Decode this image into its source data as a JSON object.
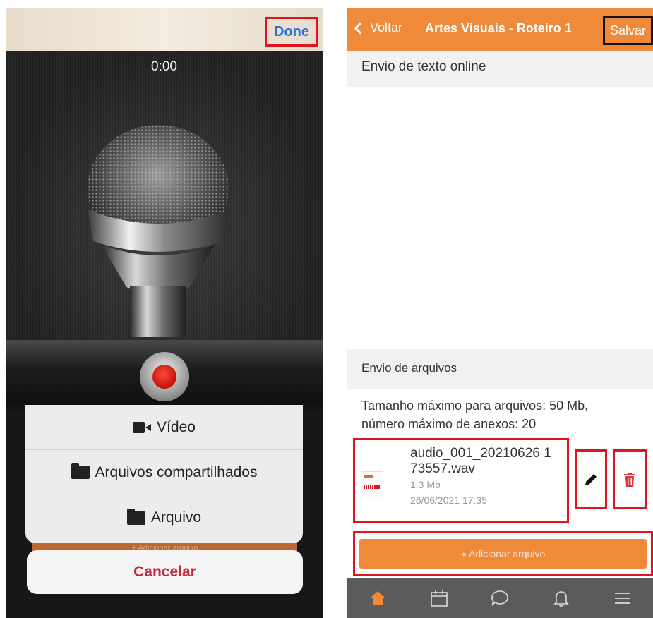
{
  "recorder": {
    "done_label": "Done",
    "timer": "0:00",
    "sheet": {
      "items": [
        {
          "label": "Vídeo",
          "icon": "video-camera-icon"
        },
        {
          "label": "Arquivos compartilhados",
          "icon": "folder-icon"
        },
        {
          "label": "Arquivo",
          "icon": "folder-icon"
        }
      ],
      "underlying_button": "+ Adicionar arquivo",
      "cancel_label": "Cancelar"
    }
  },
  "app": {
    "nav": {
      "back_label": "Voltar",
      "title": "Artes Visuais - Roteiro 1",
      "save_label": "Salvar"
    },
    "online_text": {
      "header": "Envio de texto online"
    },
    "files": {
      "header": "Envio de arquivos",
      "limits_line1": "Tamanho máximo para arquivos: 50 Mb,",
      "limits_line2": "número máximo de anexos: 20",
      "items": [
        {
          "name": "audio_001_20210626 173557.wav",
          "size": "1.3 Mb",
          "date": "26/06/2021 17:35"
        }
      ],
      "add_label": "+ Adicionar arquivo"
    },
    "tabbar": [
      "home-icon",
      "calendar-icon",
      "chat-icon",
      "bell-icon",
      "menu-icon"
    ]
  },
  "colors": {
    "accent": "#ee8a3a",
    "highlight": "#e0141e",
    "cancel": "#c2283a",
    "tabbar": "#5b5b5b"
  }
}
